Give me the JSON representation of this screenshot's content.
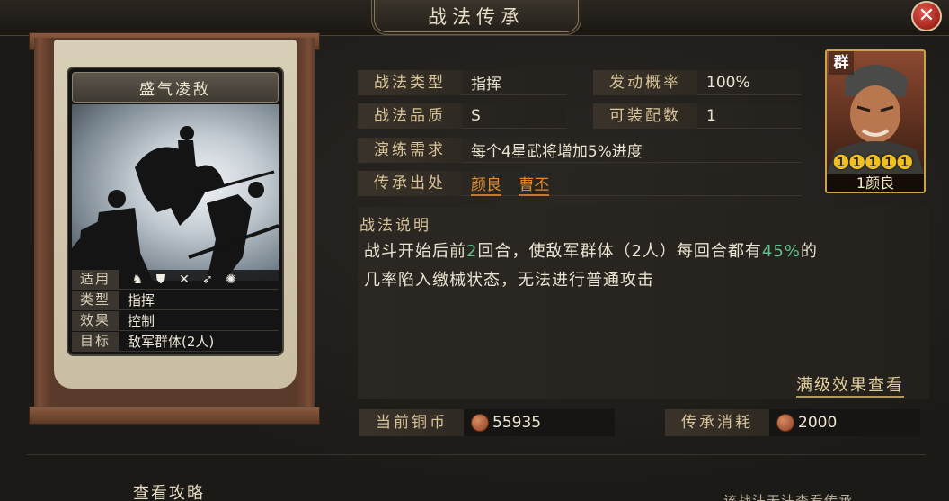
{
  "header": {
    "title": "战法传承",
    "close_icon": "close-icon"
  },
  "card": {
    "name": "盛气凌敌",
    "rows": [
      {
        "key": "适用",
        "icons": [
          "cavalry-icon",
          "shield-icon",
          "bow-icon",
          "spear-icon",
          "wheel-icon"
        ]
      },
      {
        "key": "类型",
        "value": "指挥"
      },
      {
        "key": "效果",
        "value": "控制"
      },
      {
        "key": "目标",
        "value": "敌军群体(2人)"
      }
    ]
  },
  "stats": {
    "type_label": "战法类型",
    "type_value": "指挥",
    "chance_label": "发动概率",
    "chance_value": "100%",
    "quality_label": "战法品质",
    "quality_value": "S",
    "slots_label": "可装配数",
    "slots_value": "1",
    "train_label": "演练需求",
    "train_value": "每个4星武将增加5%进度",
    "source_label": "传承出处",
    "source_links": [
      "颜良",
      "曹丕"
    ]
  },
  "description": {
    "title": "战法说明",
    "line1_a": "战斗开始后前",
    "line1_b": "2",
    "line1_c": "回合，使敌军群体（2人）每回合都有",
    "line1_d": "45%",
    "line1_e": "的",
    "line2": "几率陷入缴械状态，无法进行普通攻击",
    "highlight_color": "#5fc08a",
    "full_link": "满级效果查看"
  },
  "hero": {
    "faction": "群",
    "stars": "❶❶❶❶❶",
    "name": "1颜良"
  },
  "costs": {
    "coins_label": "当前铜币",
    "coins_value": "55935",
    "cost_label": "传承消耗",
    "cost_value": "2000"
  },
  "footer": {
    "guide": "查看攻略",
    "note": "该战法无法查看传承"
  }
}
